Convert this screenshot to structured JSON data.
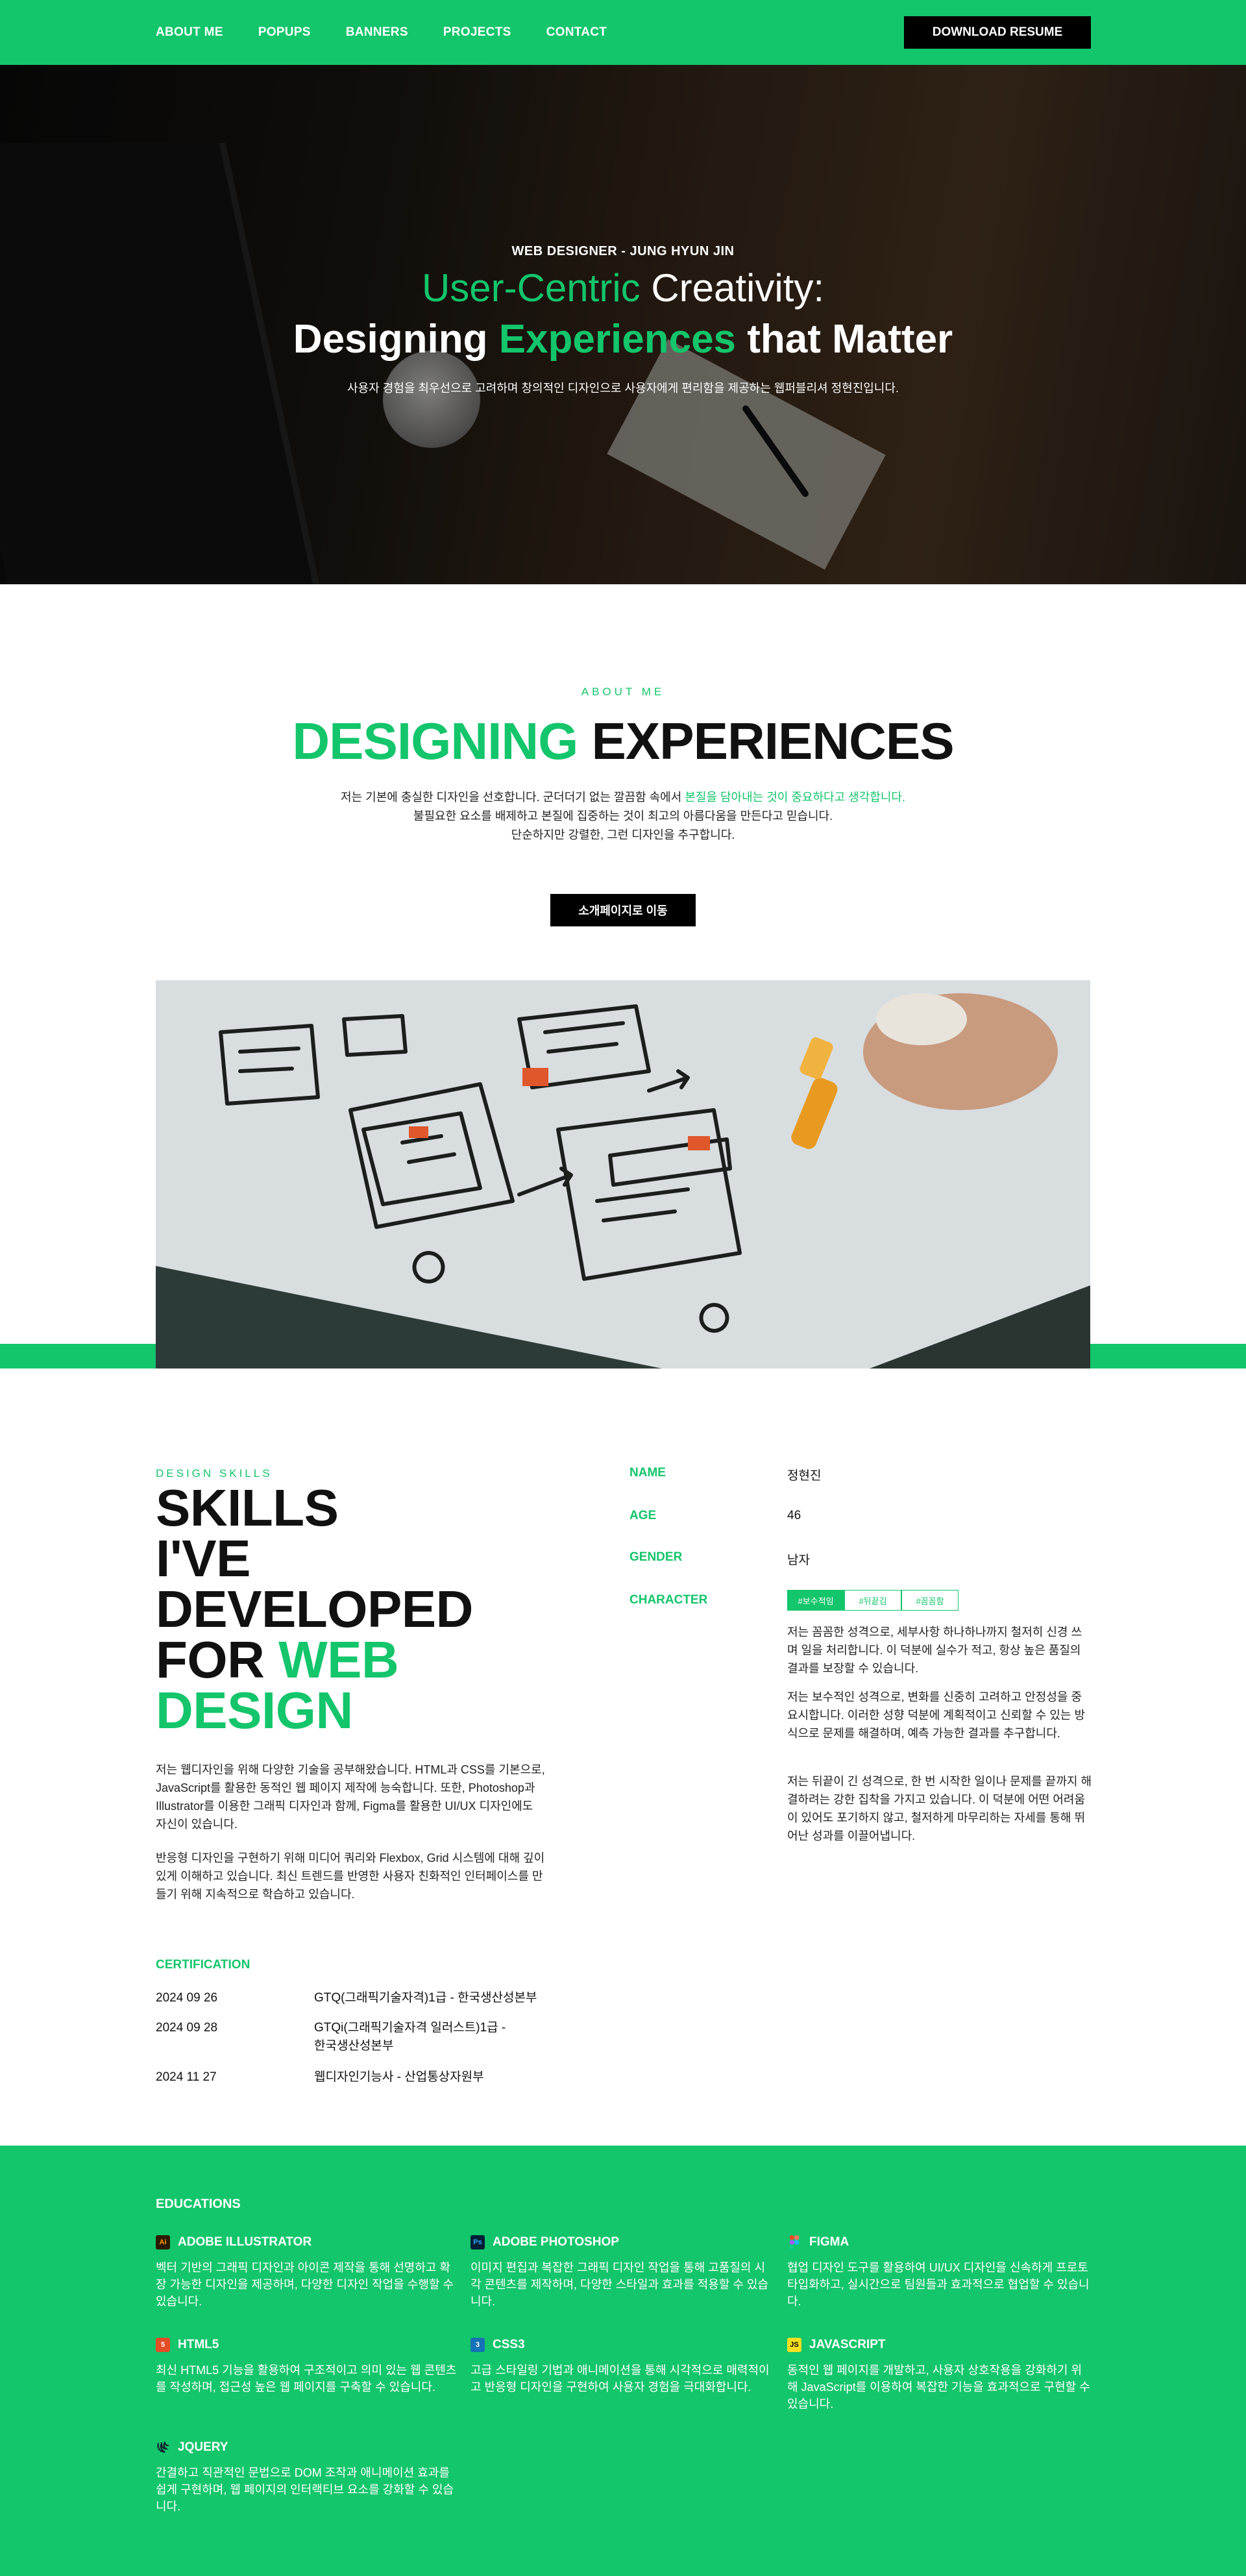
{
  "nav": {
    "links": [
      "ABOUT ME",
      "POPUPS",
      "BANNERS",
      "PROJECTS",
      "CONTACT"
    ],
    "download": "DOWNLOAD RESUME"
  },
  "hero": {
    "subtitle": "WEB DESIGNER - JUNG HYUN JIN",
    "line1_green": "User-Centric",
    "line1_rest": " Creativity:",
    "line2_a": "Designing ",
    "line2_green": "Experiences",
    "line2_b": " that Matter",
    "desc": "사용자 경험을 최우선으로 고려하며 창의적인 디자인으로 사용자에게 편리함을 제공하는 웹퍼블리셔 정현진입니다."
  },
  "about": {
    "eyebrow": "ABOUT ME",
    "title_green": "DESIGNING",
    "title_rest": " EXPERIENCES",
    "desc1_a": "저는 기본에 충실한 디자인을 선호합니다. 군더더기 없는 깔끔함 속에서 ",
    "desc1_green": "본질을 담아내는 것이 중요하다고 생각합니다.",
    "desc2": "불필요한 요소를 배제하고 본질에 집중하는 것이 최고의 아름다움을 만든다고 믿습니다.",
    "desc3": "단순하지만 강렬한, 그런 디자인을 추구합니다.",
    "button": "소개페이지로 이동"
  },
  "skills": {
    "eyebrow": "DESIGN SKILLS",
    "title_lines": [
      "SKILLS",
      "I'VE",
      "DEVELOPED"
    ],
    "title_for": "FOR ",
    "title_web": "WEB",
    "title_design": "DESIGN",
    "para1": "저는 웹디자인을 위해 다양한 기술을 공부해왔습니다. HTML과 CSS를 기본으로, JavaScript를 활용한 동적인 웹 페이지 제작에 능숙합니다. 또한, Photoshop과 Illustrator를 이용한 그래픽 디자인과 함께, Figma를 활용한 UI/UX 디자인에도 자신이 있습니다.",
    "para2": "반응형 디자인을 구현하기 위해 미디어 쿼리와 Flexbox, Grid 시스템에 대해 깊이 있게 이해하고 있습니다. 최신 트렌드를 반영한 사용자 친화적인 인터페이스를 만들기 위해 지속적으로 학습하고 있습니다."
  },
  "certification": {
    "heading": "CERTIFICATION",
    "rows": [
      {
        "date": "2024 09 26",
        "name": "GTQ(그래픽기술자격)1급 - 한국생산성본부"
      },
      {
        "date": "2024 09 28",
        "name": "GTQi(그래픽기술자격 일러스트)1급 - 한국생산성본부"
      },
      {
        "date": "2024 11 27",
        "name": "웹디자인기능사 - 산업통상자원부"
      }
    ]
  },
  "profile": {
    "name_label": "NAME",
    "name": "정현진",
    "age_label": "AGE",
    "age": "46",
    "gender_label": "GENDER",
    "gender": "남자",
    "character_label": "CHARACTER",
    "tags": [
      "#보수적임",
      "#뒤끝김",
      "#꼼꼼함"
    ],
    "char_p1": "저는 꼼꼼한 성격으로, 세부사항 하나하나까지 철저히 신경 쓰며 일을 처리합니다. 이 덕분에 실수가 적고, 항상 높은 품질의 결과를 보장할 수 있습니다.",
    "char_p2": "저는 보수적인 성격으로, 변화를 신중히 고려하고 안정성을 중요시합니다. 이러한 성향 덕분에 계획적이고 신뢰할 수 있는 방식으로 문제를 해결하며, 예측 가능한 결과를 추구합니다.",
    "char_p3": "저는 뒤끝이 긴 성격으로, 한 번 시작한 일이나 문제를 끝까지 해결하려는 강한 집착을 가지고 있습니다. 이 덕분에 어떤 어려움이 있어도 포기하지 않고, 철저하게 마무리하는 자세를 통해 뛰어난 성과를 이끌어냅니다."
  },
  "educations": {
    "heading": "EDUCATIONS",
    "items": [
      {
        "title": "ADOBE ILLUSTRATOR",
        "icon": "Ai",
        "desc": "벡터 기반의 그래픽 디자인과 아이콘 제작을 통해 선명하고 확장 가능한 디자인을 제공하며, 다양한 디자인 작업을 수행할 수 있습니다."
      },
      {
        "title": "ADOBE PHOTOSHOP",
        "icon": "Ps",
        "desc": "이미지 편집과 복잡한 그래픽 디자인 작업을 통해 고품질의 시각 콘텐츠를 제작하며, 다양한 스타일과 효과를 적용할 수 있습니다."
      },
      {
        "title": "FIGMA",
        "icon": "figma-icon",
        "desc": "협업 디자인 도구를 활용하여 UI/UX 디자인을 신속하게 프로토타입화하고, 실시간으로 팀원들과 효과적으로 협업할 수 있습니다."
      },
      {
        "title": "HTML5",
        "icon": "5",
        "desc": "최신 HTML5 기능을 활용하여 구조적이고 의미 있는 웹 콘텐츠를 작성하며, 접근성 높은 웹 페이지를 구축할 수 있습니다."
      },
      {
        "title": "CSS3",
        "icon": "3",
        "desc": "고급 스타일링 기법과 애니메이션을 통해 시각적으로 매력적이고 반응형 디자인을 구현하여 사용자 경험을 극대화합니다."
      },
      {
        "title": "JAVASCRIPT",
        "icon": "JS",
        "desc": "동적인 웹 페이지를 개발하고, 사용자 상호작용을 강화하기 위해 JavaScript를 이용하여 복잡한 기능을 효과적으로 구현할 수 있습니다."
      },
      {
        "title": "JQUERY",
        "icon": "jquery-icon",
        "desc": "간결하고 직관적인 문법으로 DOM 조작과 애니메이션 효과를 쉽게 구현하며, 웹 페이지의 인터랙티브 요소를 강화할 수 있습니다."
      }
    ]
  },
  "colors": {
    "accent": "#13c56b",
    "dark": "#000000"
  }
}
